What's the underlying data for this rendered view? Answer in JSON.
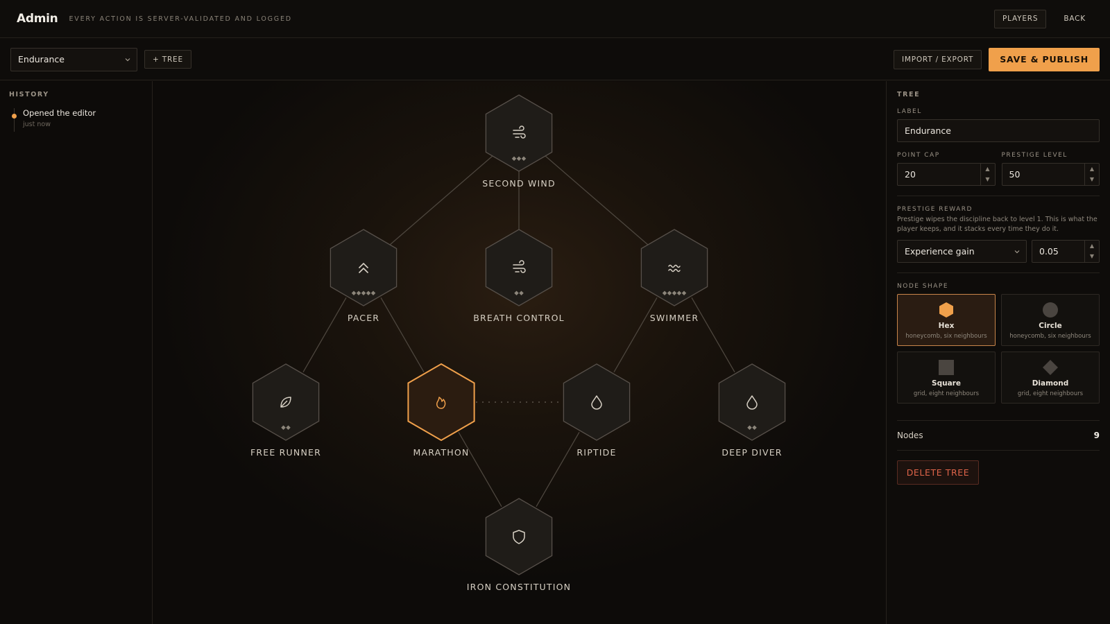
{
  "header": {
    "brand": "Admin",
    "tagline": "EVERY ACTION IS SERVER-VALIDATED AND LOGGED",
    "players_label": "PLAYERS",
    "back_label": "BACK"
  },
  "toolbar": {
    "tree_select_value": "Endurance",
    "add_tree_label": "+ TREE",
    "import_export_label": "IMPORT / EXPORT",
    "save_publish_label": "SAVE & PUBLISH"
  },
  "history": {
    "title": "HISTORY",
    "entries": [
      {
        "title": "Opened the editor",
        "time": "just now"
      }
    ]
  },
  "tree": {
    "nodes": [
      {
        "id": "second-wind",
        "label": "SECOND WIND",
        "icon": "wind-icon",
        "pips": 3,
        "col": 3,
        "row": 0,
        "selected": false
      },
      {
        "id": "pacer",
        "label": "PACER",
        "icon": "chevrons-up-icon",
        "pips": 5,
        "col": 1,
        "row": 1,
        "selected": false
      },
      {
        "id": "breath-control",
        "label": "BREATH CONTROL",
        "icon": "wind-icon",
        "pips": 2,
        "col": 3,
        "row": 1,
        "selected": false
      },
      {
        "id": "swimmer",
        "label": "SWIMMER",
        "icon": "waves-icon",
        "pips": 5,
        "col": 5,
        "row": 1,
        "selected": false
      },
      {
        "id": "free-runner",
        "label": "FREE RUNNER",
        "icon": "leaf-icon",
        "pips": 2,
        "col": 0,
        "row": 2,
        "selected": false
      },
      {
        "id": "marathon",
        "label": "MARATHON",
        "icon": "flame-icon",
        "pips": 0,
        "col": 2,
        "row": 2,
        "selected": true
      },
      {
        "id": "riptide",
        "label": "RIPTIDE",
        "icon": "droplet-icon",
        "pips": 0,
        "col": 4,
        "row": 2,
        "selected": false
      },
      {
        "id": "deep-diver",
        "label": "DEEP DIVER",
        "icon": "droplet-icon",
        "pips": 2,
        "col": 6,
        "row": 2,
        "selected": false
      },
      {
        "id": "iron-constitution",
        "label": "IRON CONSTITUTION",
        "icon": "shield-icon",
        "pips": 0,
        "col": 3,
        "row": 3,
        "selected": false
      }
    ],
    "edges": [
      [
        "second-wind",
        "pacer",
        "solid"
      ],
      [
        "second-wind",
        "breath-control",
        "solid"
      ],
      [
        "second-wind",
        "swimmer",
        "solid"
      ],
      [
        "pacer",
        "free-runner",
        "solid"
      ],
      [
        "pacer",
        "marathon",
        "solid"
      ],
      [
        "swimmer",
        "riptide",
        "solid"
      ],
      [
        "swimmer",
        "deep-diver",
        "solid"
      ],
      [
        "marathon",
        "iron-constitution",
        "solid"
      ],
      [
        "riptide",
        "iron-constitution",
        "solid"
      ],
      [
        "marathon",
        "riptide",
        "dotted"
      ]
    ],
    "accent_color": "#f0a04b"
  },
  "panel": {
    "title": "TREE",
    "label_field": {
      "label": "LABEL",
      "value": "Endurance"
    },
    "point_cap": {
      "label": "POINT CAP",
      "value": "20"
    },
    "prestige_level": {
      "label": "PRESTIGE LEVEL",
      "value": "50"
    },
    "prestige_reward": {
      "label": "PRESTIGE REWARD",
      "hint": "Prestige wipes the discipline back to level 1. This is what the player keeps, and it stacks every time they do it.",
      "type_value": "Experience gain",
      "amount": "0.05"
    },
    "node_shape": {
      "label": "NODE SHAPE",
      "options": [
        {
          "name": "Hex",
          "desc": "honeycomb, six neighbours",
          "selected": true
        },
        {
          "name": "Circle",
          "desc": "honeycomb, six neighbours",
          "selected": false
        },
        {
          "name": "Square",
          "desc": "grid, eight neighbours",
          "selected": false
        },
        {
          "name": "Diamond",
          "desc": "grid, eight neighbours",
          "selected": false
        }
      ]
    },
    "nodes_stat": {
      "label": "Nodes",
      "value": "9"
    },
    "delete_label": "DELETE TREE"
  }
}
